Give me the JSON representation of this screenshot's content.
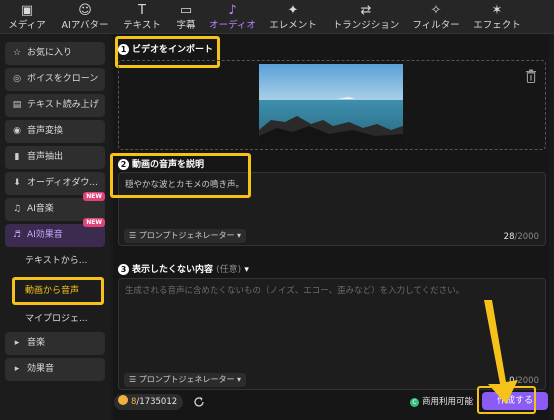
{
  "toolbar": {
    "items": [
      {
        "label": "メディア",
        "icon": "media-icon",
        "glyph": "▣"
      },
      {
        "label": "AIアバター",
        "icon": "avatar-icon",
        "glyph": "☺"
      },
      {
        "label": "テキスト",
        "icon": "text-icon",
        "glyph": "T"
      },
      {
        "label": "字幕",
        "icon": "subtitle-icon",
        "glyph": "▭"
      },
      {
        "label": "オーディオ",
        "icon": "audio-icon",
        "glyph": "♪"
      },
      {
        "label": "エレメント",
        "icon": "element-icon",
        "glyph": "✦"
      },
      {
        "label": "トランジション",
        "icon": "transition-icon",
        "glyph": "⇄"
      },
      {
        "label": "フィルター",
        "icon": "filter-icon",
        "glyph": "✧"
      },
      {
        "label": "エフェクト",
        "icon": "effect-icon",
        "glyph": "✶"
      }
    ],
    "active_index": 4
  },
  "sidebar": {
    "items": [
      {
        "label": "お気に入り",
        "icon": "star-icon",
        "glyph": "☆"
      },
      {
        "label": "ボイスをクローン",
        "icon": "voice-clone-icon",
        "glyph": "◎"
      },
      {
        "label": "テキスト読み上げ",
        "icon": "text-to-speech-icon",
        "glyph": "▤"
      },
      {
        "label": "音声変換",
        "icon": "voice-change-icon",
        "glyph": "◉"
      },
      {
        "label": "音声抽出",
        "icon": "mic-icon",
        "glyph": "▮"
      },
      {
        "label": "オーディオダウ...",
        "icon": "download-icon",
        "glyph": "⬇"
      },
      {
        "label": "AI音楽",
        "icon": "ai-music-icon",
        "glyph": "♫"
      },
      {
        "label": "AI効果音",
        "icon": "ai-sfx-icon",
        "glyph": "♬"
      }
    ],
    "new_badge": "NEW",
    "subitems": [
      "テキストから...",
      "動画から音声",
      "マイプロジェ..."
    ],
    "groups": [
      {
        "label": "音楽",
        "glyph": "▸"
      },
      {
        "label": "効果音",
        "glyph": "▸"
      }
    ]
  },
  "steps": {
    "one": {
      "number": "1",
      "title": "ビデオをインポート"
    },
    "two": {
      "number": "2",
      "title": "動画の音声を説明",
      "text": "穏やかな波とカモメの鳴き声。",
      "count_current": "28",
      "count_total": "/2000"
    },
    "three": {
      "number": "3",
      "title": "表示したくない内容",
      "optional": "(任意)",
      "placeholder": "生成される音声に含めたくないもの（ノイズ、エコー、歪みなど）を入力してください。",
      "count_current": "0",
      "count_total": "/2000"
    }
  },
  "prompt_generator": "プロンプトジェネレーター",
  "footer": {
    "credits_current": "8",
    "credits_total": "/1735012",
    "commercial_icon": "C",
    "commercial": "商用利用可能",
    "create": "作成する"
  },
  "colors": {
    "accent": "#8a5cf5",
    "highlight": "#f6c21a",
    "new_badge": "#e0437a"
  }
}
